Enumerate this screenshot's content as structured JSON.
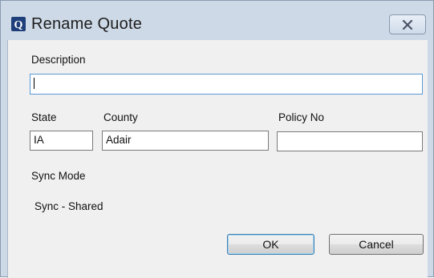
{
  "window": {
    "title": "Rename Quote",
    "app_icon_letter": "Q",
    "close_icon": "close-x-icon"
  },
  "form": {
    "description_label": "Description",
    "description_value": "",
    "state_label": "State",
    "state_value": "IA",
    "county_label": "County",
    "county_value": "Adair",
    "policy_label": "Policy No",
    "policy_value": "",
    "sync_mode_label": "Sync Mode",
    "sync_mode_value": "Sync - Shared"
  },
  "buttons": {
    "ok": "OK",
    "cancel": "Cancel"
  },
  "colors": {
    "title_bar": "#cdd9e6",
    "client_bg": "#f0f0f0",
    "focus_border": "#5b9bd5",
    "app_icon_bg": "#1f3f7a"
  }
}
